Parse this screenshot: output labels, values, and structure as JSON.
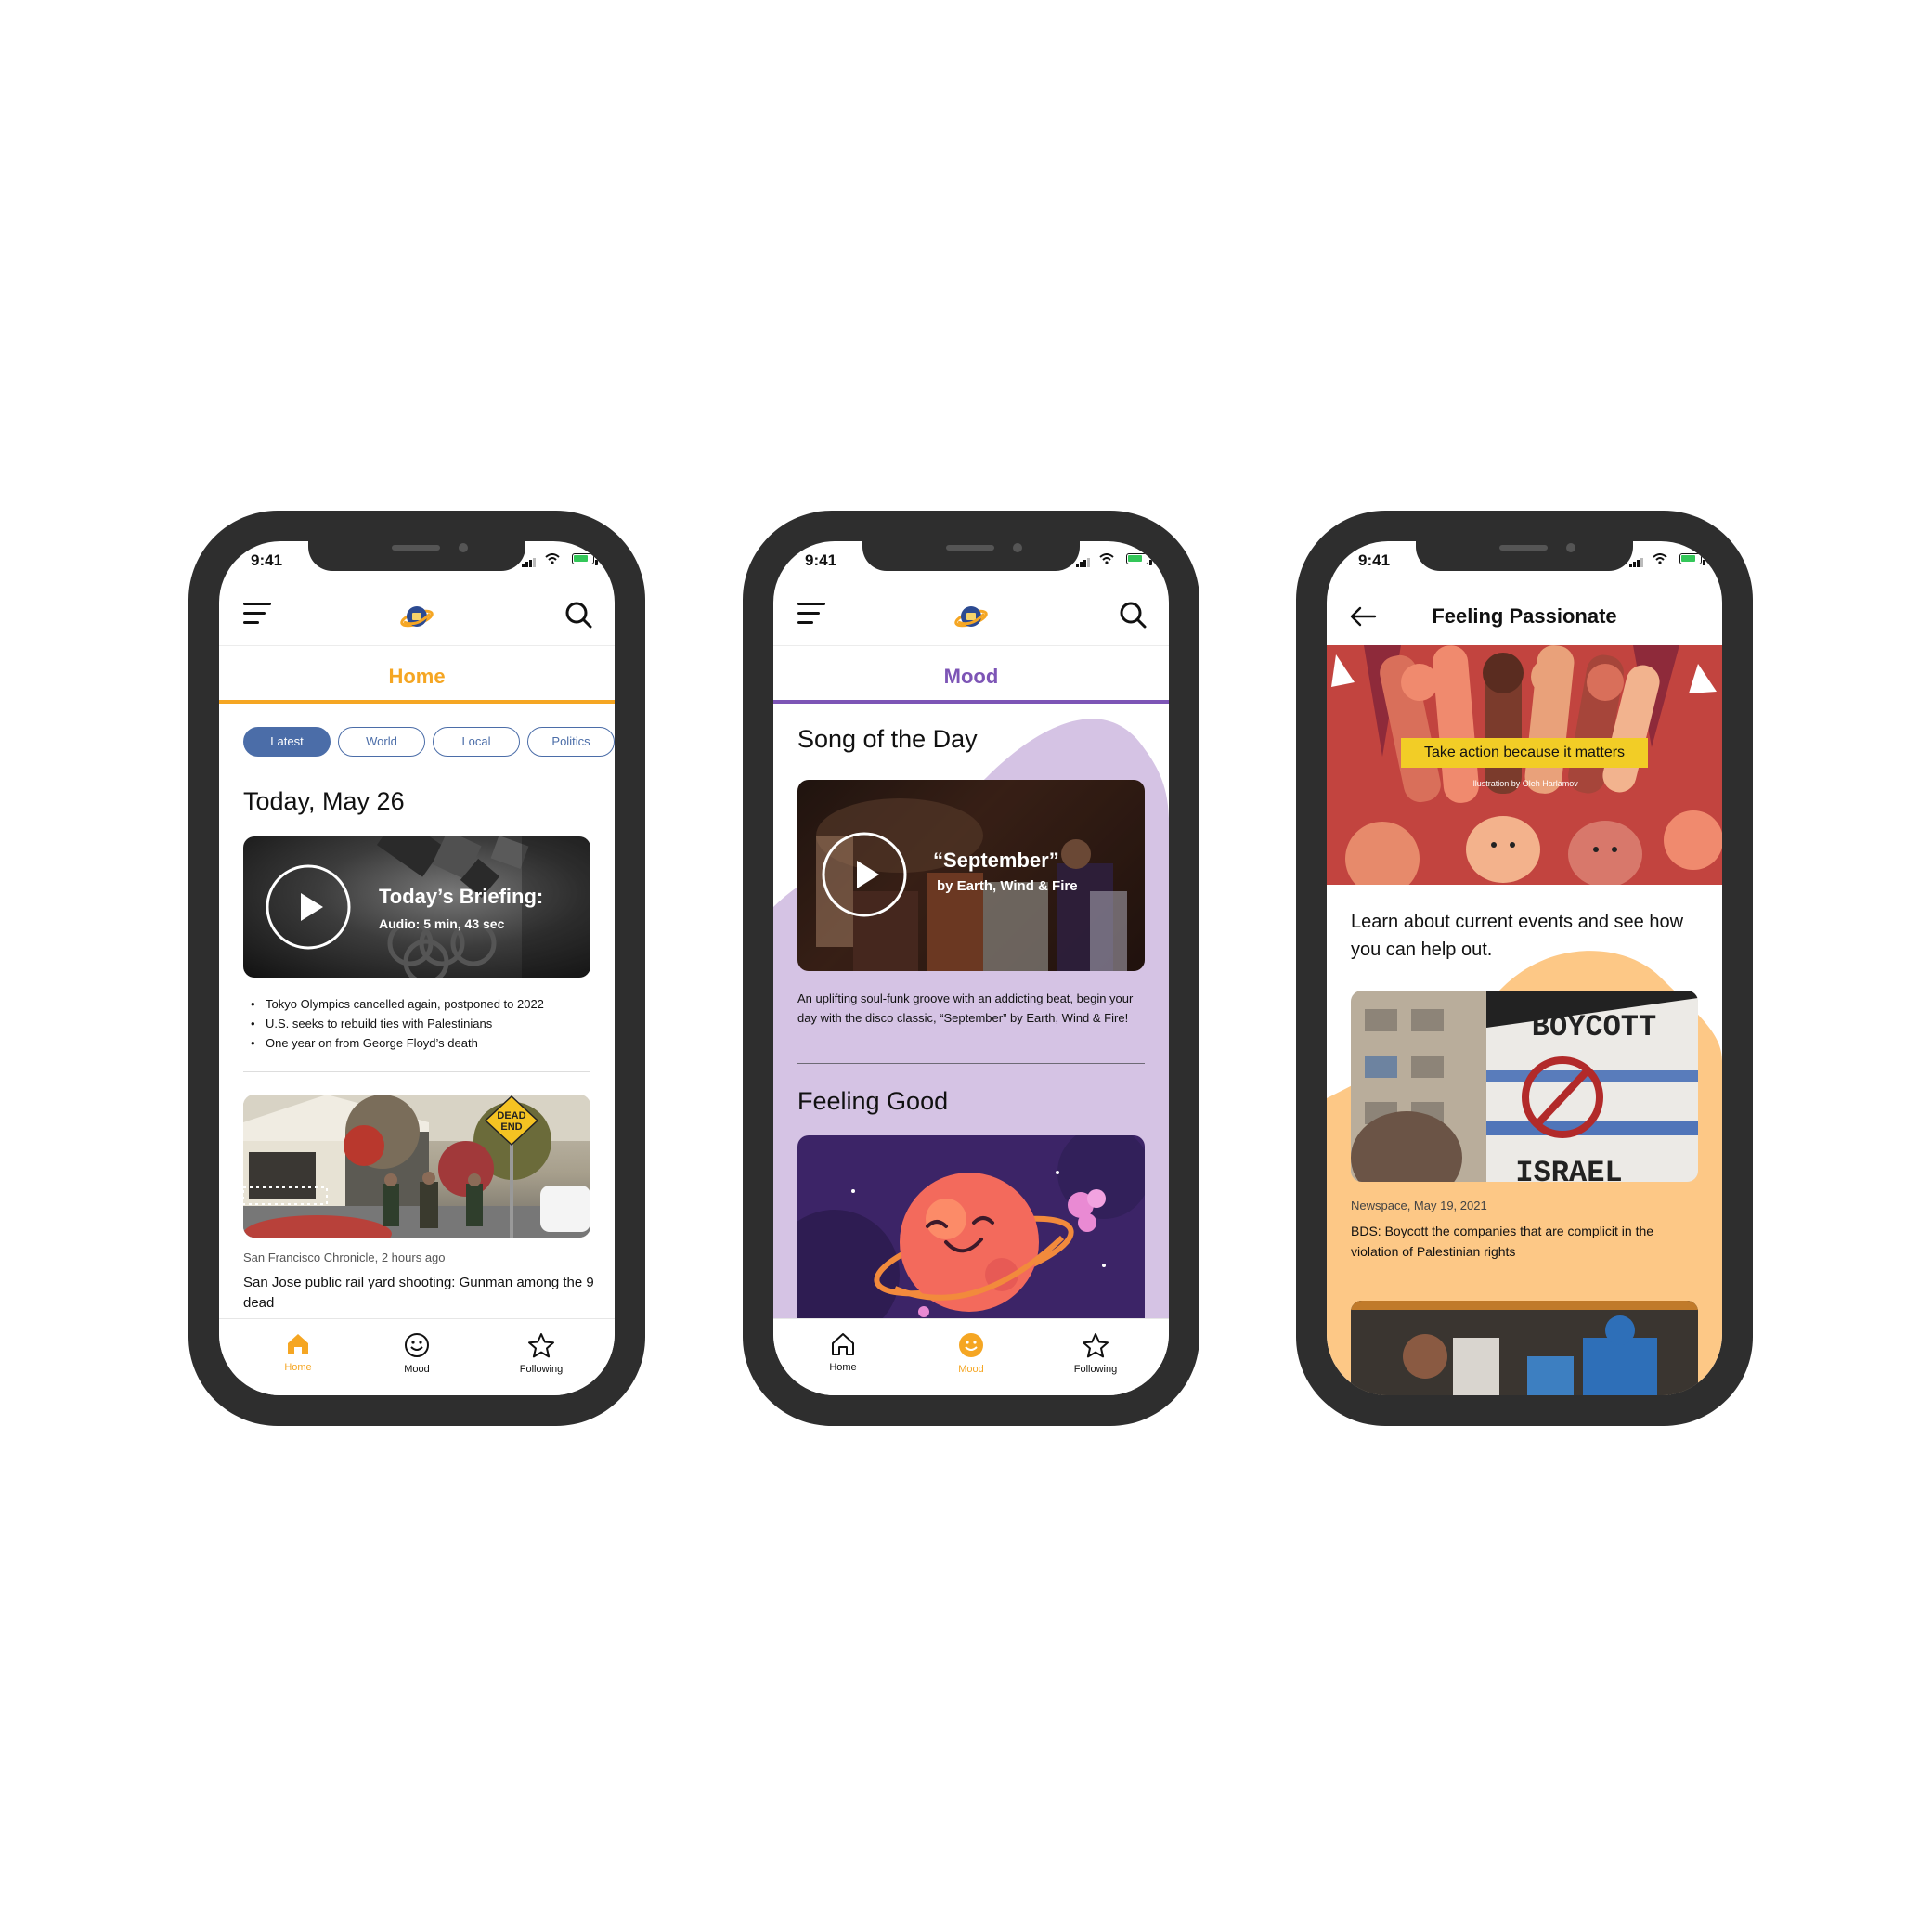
{
  "status": {
    "time": "9:41"
  },
  "home": {
    "tab_title": "Home",
    "filters": [
      "Latest",
      "World",
      "Local",
      "Politics"
    ],
    "date_heading": "Today, May 26",
    "briefing": {
      "title": "Today’s Briefing:",
      "subtitle": "Audio: 5 min, 43 sec"
    },
    "bullets": [
      "Tokyo Olympics cancelled again, postponed to 2022",
      "U.S. seeks to rebuild ties with Palestinians",
      "One year on from George Floyd’s death"
    ],
    "article": {
      "meta": "San Francisco Chronicle, 2 hours ago",
      "headline": "San Jose public rail yard shooting: Gunman among the 9 dead",
      "sign_line1": "DEAD",
      "sign_line2": "END"
    }
  },
  "mood": {
    "tab_title": "Mood",
    "song_heading": "Song of the Day",
    "song_title": "“September”",
    "song_artist": "by Earth, Wind & Fire",
    "song_description": "An uplifting soul-funk groove with an addicting beat, begin your day with the disco classic, “September” by Earth, Wind & Fire!",
    "feeling_heading": "Feeling Good"
  },
  "passionate": {
    "title": "Feeling Passionate",
    "banner_caption": "Take action because it matters",
    "banner_credit": "Illustration by Oleh Harlamov",
    "intro": "Learn about current events and see how you can help out.",
    "article_meta": "Newspace, May 19, 2021",
    "article_headline": "BDS: Boycott the companies that are complicit in the violation of Palestinian rights",
    "sign_top": "BOYCOTT",
    "sign_bottom": "ISRAEL"
  },
  "tabs": {
    "home": "Home",
    "mood": "Mood",
    "following": "Following"
  },
  "colors": {
    "home_accent": "#f5a623",
    "mood_accent": "#7d55b6",
    "pill_active": "#4b6da8",
    "mood_bg": "#d5c3e4",
    "passion_bg": "#fdc886",
    "banner_caption_bg": "#f2cd26"
  },
  "icons": [
    "menu-icon",
    "search-icon",
    "play-icon",
    "home-icon",
    "smiley-icon",
    "star-icon",
    "back-arrow-icon"
  ]
}
